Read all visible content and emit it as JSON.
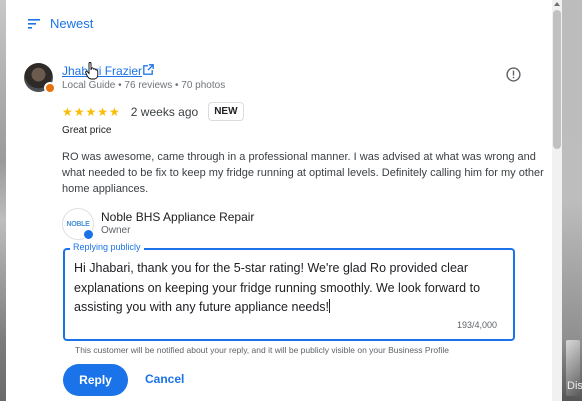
{
  "sort": {
    "label": "Newest",
    "icon": "sort-icon"
  },
  "review": {
    "reviewer_name": "Jhabari Frazier",
    "reviewer_meta": "Local Guide • 76 reviews • 70 photos",
    "stars": "★★★★★",
    "rating": 5,
    "time": "2 weeks ago",
    "badge": "NEW",
    "title": "Great price",
    "body": "RO was awesome, came through in a professional manner. I was advised at what was wrong and what needed to be fix to keep my fridge running at optimal levels. Definitely calling him for my other home appliances."
  },
  "owner": {
    "logo_text": "NOBLE",
    "name": "Noble BHS Appliance Repair",
    "role": "Owner"
  },
  "reply": {
    "legend": "Replying publicly",
    "text": "Hi Jhabari, thank you for the 5-star rating! We're glad Ro provided clear explanations on keeping your fridge running smoothly. We look forward to assisting you with any future appliance needs!",
    "counter": "193/4,000",
    "notice": "This customer will be notified about your reply, and it will be publicly visible on your Business Profile"
  },
  "actions": {
    "reply_label": "Reply",
    "cancel_label": "Cancel"
  },
  "background": {
    "partial_text": "Disp"
  },
  "colors": {
    "accent": "#1a73e8",
    "star": "#fbbc04",
    "guide_badge": "#e8710a"
  }
}
